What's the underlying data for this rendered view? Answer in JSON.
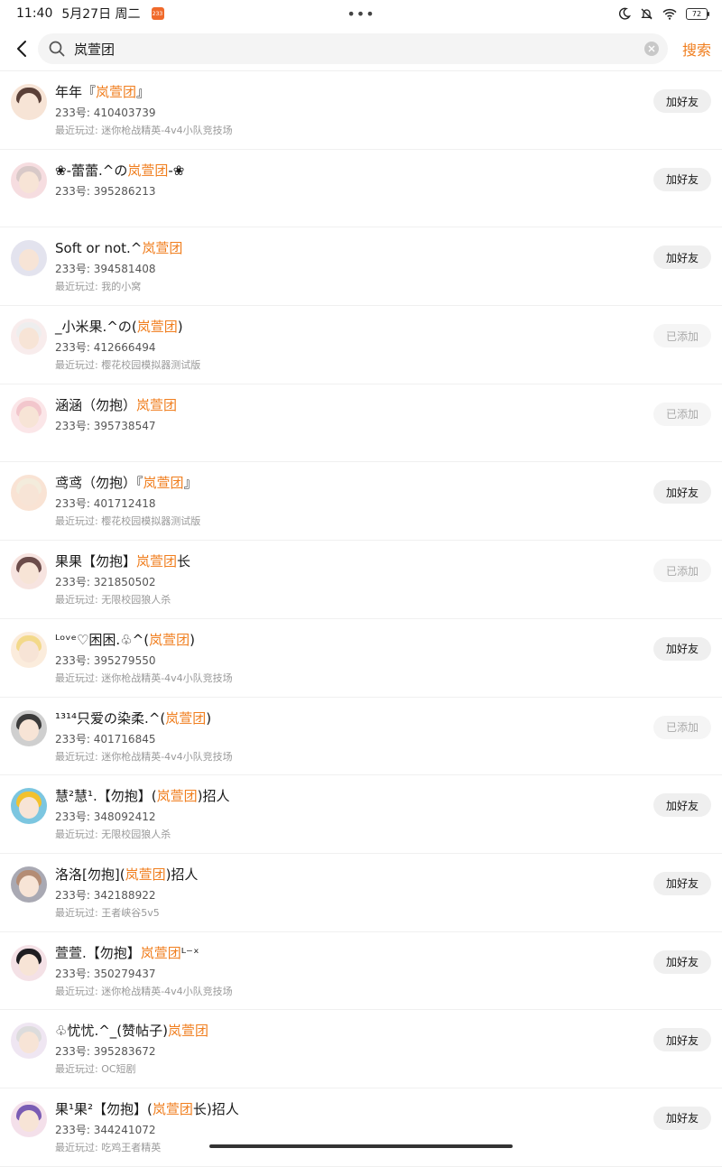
{
  "status_bar": {
    "time": "11:40",
    "date": "5月27日 周二",
    "app_badge": "233",
    "dots": "•••",
    "battery": "72"
  },
  "search": {
    "query": "岚萱团",
    "action_label": "搜索"
  },
  "colors": {
    "accent": "#f07e1e"
  },
  "results": [
    {
      "name_pre": "年年『",
      "highlight": "岚萱团",
      "name_post": "』",
      "uid": "233号: 410403739",
      "recent": "最近玩过: 迷你枪战精英-4v4小队竞技场",
      "button": "加好友",
      "added": false,
      "avatar_colors": [
        "#5a4038",
        "#f7e4d6"
      ]
    },
    {
      "name_pre": "❀-蕾蕾.^の",
      "highlight": "岚萱团",
      "name_post": "-❀",
      "uid": "233号: 395286213",
      "recent": "",
      "button": "加好友",
      "added": false,
      "avatar_colors": [
        "#d8c9c8",
        "#f6dde0"
      ]
    },
    {
      "name_pre": "Soft or not.^",
      "highlight": "岚萱团",
      "name_post": "",
      "uid": "233号: 394581408",
      "recent": "最近玩过: 我的小窝",
      "button": "加好友",
      "added": false,
      "avatar_colors": [
        "#e3e3ee",
        "#e3e3ee"
      ]
    },
    {
      "name_pre": "_小米果.^の(",
      "highlight": "岚萱团",
      "name_post": ")",
      "uid": "233号: 412666494",
      "recent": "最近玩过: 樱花校园模拟器测试版",
      "button": "已添加",
      "added": true,
      "avatar_colors": [
        "#eeeeee",
        "#f8ecec"
      ]
    },
    {
      "name_pre": "涵涵（勿抱）",
      "highlight": "岚萱团",
      "name_post": "",
      "uid": "233号: 395738547",
      "recent": "",
      "button": "已添加",
      "added": true,
      "avatar_colors": [
        "#f2c6cc",
        "#fbe6e8"
      ]
    },
    {
      "name_pre": "鸢鸢（勿抱）『",
      "highlight": "岚萱团",
      "name_post": "』",
      "uid": "233号: 401712418",
      "recent": "最近玩过: 樱花校园模拟器测试版",
      "button": "加好友",
      "added": false,
      "avatar_colors": [
        "#f3ecdc",
        "#f9e3d4"
      ]
    },
    {
      "name_pre": "果果【勿抱】",
      "highlight": "岚萱团",
      "name_post": "长",
      "uid": "233号: 321850502",
      "recent": "最近玩过: 无限校园狼人杀",
      "button": "已添加",
      "added": true,
      "avatar_colors": [
        "#6b4c4a",
        "#f7e4e0"
      ]
    },
    {
      "name_pre": "ᴸᵒᵛᵉ♡困困.♧^(",
      "highlight": "岚萱团",
      "name_post": ")",
      "uid": "233号: 395279550",
      "recent": "最近玩过: 迷你枪战精英-4v4小队竞技场",
      "button": "加好友",
      "added": false,
      "avatar_colors": [
        "#f3d98a",
        "#fbecdc"
      ]
    },
    {
      "name_pre": "¹³¹⁴只爱の染柔.^(",
      "highlight": "岚萱团",
      "name_post": ")",
      "uid": "233号: 401716845",
      "recent": "最近玩过: 迷你枪战精英-4v4小队竞技场",
      "button": "已添加",
      "added": true,
      "avatar_colors": [
        "#3b3b3b",
        "#cfcfcf"
      ]
    },
    {
      "name_pre": "慧²慧¹.【勿抱】(",
      "highlight": "岚萱团",
      "name_post": ")招人",
      "uid": "233号: 348092412",
      "recent": "最近玩过: 无限校园狼人杀",
      "button": "加好友",
      "added": false,
      "avatar_colors": [
        "#f2c12e",
        "#7cc6e0"
      ]
    },
    {
      "name_pre": "洛洛[勿抱](",
      "highlight": "岚萱团",
      "name_post": ")招人",
      "uid": "233号: 342188922",
      "recent": "最近玩过: 王者峡谷5v5",
      "button": "加好友",
      "added": false,
      "avatar_colors": [
        "#b48c74",
        "#a9a9b3"
      ]
    },
    {
      "name_pre": "萱萱.【勿抱】",
      "highlight": "岚萱团",
      "name_post": "ᴸ⁻ˣ",
      "uid": "233号: 350279437",
      "recent": "最近玩过: 迷你枪战精英-4v4小队竞技场",
      "button": "加好友",
      "added": false,
      "avatar_colors": [
        "#1e1e22",
        "#f4e1e6"
      ]
    },
    {
      "name_pre": "♧忧忧.^_(赞帖子)",
      "highlight": "岚萱团",
      "name_post": "",
      "uid": "233号: 395283672",
      "recent": "最近玩过: OC短剧",
      "button": "加好友",
      "added": false,
      "avatar_colors": [
        "#dcdcdc",
        "#efe6f2"
      ]
    },
    {
      "name_pre": "果¹果²【勿抱】(",
      "highlight": "岚萱团",
      "name_post": "长)招人",
      "uid": "233号: 344241072",
      "recent": "最近玩过: 吃鸡王者精英",
      "button": "加好友",
      "added": false,
      "avatar_colors": [
        "#7a5cb4",
        "#f4e0ea"
      ]
    }
  ]
}
